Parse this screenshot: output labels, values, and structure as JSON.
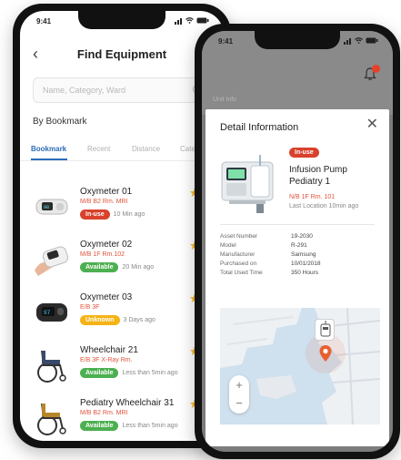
{
  "phone1": {
    "status_time": "9:41",
    "title": "Find Equipment",
    "search_placeholder": "Name, Category, Ward",
    "section_label": "By Bookmark",
    "tabs": [
      {
        "label": "Bookmark"
      },
      {
        "label": "Recent"
      },
      {
        "label": "Distance"
      },
      {
        "label": "Catego"
      }
    ],
    "items": [
      {
        "name": "Oxymeter 01",
        "location": "M/B B2 Rm. MRI",
        "status": "In-use",
        "time": "10 Min ago",
        "thumb": "oxymeter-icon"
      },
      {
        "name": "Oxymeter 02",
        "location": "M/B 1F Rm.102",
        "status": "Available",
        "time": "20 Min ago",
        "thumb": "oxymeter-hand-icon"
      },
      {
        "name": "Oxymeter 03",
        "location": "E/B 3F",
        "status": "Unknown",
        "time": "3 Days ago",
        "thumb": "oxymeter-dark-icon"
      },
      {
        "name": "Wheelchair 21",
        "location": "E/B 3F X-Ray Rm.",
        "status": "Available",
        "time": "Less than 5min ago",
        "thumb": "wheelchair-icon"
      },
      {
        "name": "Pediatry Wheelchair 31",
        "location": "M/B B2 Rm. MRI",
        "status": "Available",
        "time": "Less than 5min ago",
        "thumb": "wheelchair-icon"
      }
    ]
  },
  "phone2": {
    "status_time": "9:41",
    "dim_header_text": "Unit Info",
    "sheet_title": "Detail Information",
    "status_badge": "In-use",
    "name": "Infusion Pump Pediatry 1",
    "location": "N/B 1F Rm. 101",
    "last_location": "Last Location 10min ago",
    "specs": [
      {
        "key": "Asset Number",
        "value": "19-2030"
      },
      {
        "key": "Model",
        "value": "R-291"
      },
      {
        "key": "Manufacturer",
        "value": "Samsung"
      },
      {
        "key": "Purchased on",
        "value": "10/01/2018"
      },
      {
        "key": "Total Used Time",
        "value": "350 Hours"
      }
    ],
    "zoom_in": "+",
    "zoom_out": "−"
  },
  "colors": {
    "accent": "#2b6cb8",
    "in_use": "#d9412c",
    "available": "#4caf50",
    "unknown": "#f5b316",
    "location_text": "#e0533a",
    "star": "#f4b41a"
  },
  "icons": {
    "back": "chevron-left-icon",
    "bell": "bell-icon",
    "search": "search-icon",
    "star": "star-icon",
    "close": "close-icon",
    "map_pin": "map-pin-icon"
  }
}
